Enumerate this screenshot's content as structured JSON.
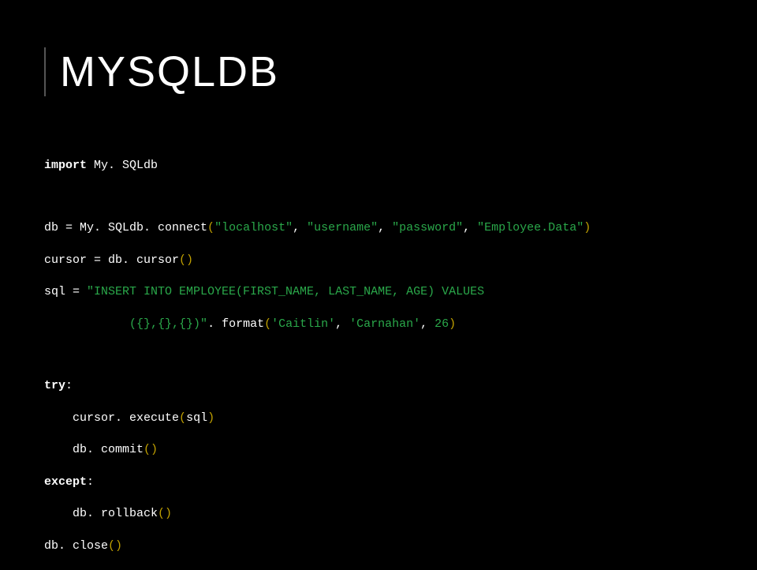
{
  "slide": {
    "title": "MYSQLDB"
  },
  "code": {
    "l1": {
      "kw": "import",
      "rest": " My. SQLdb"
    },
    "l2a": "db = My. SQLdb. connect",
    "l2p1": "(",
    "l2s1": "\"localhost\"",
    "l2c1": ", ",
    "l2s2": "\"username\"",
    "l2c2": ", ",
    "l2s3": "\"password\"",
    "l2c3": ", ",
    "l2s4": "\"Employee.Data\"",
    "l2p2": ")",
    "l3a": "cursor = db. cursor",
    "l3p": "()",
    "l4a": "sql = ",
    "l4s": "\"INSERT INTO EMPLOYEE(FIRST_NAME, LAST_NAME, AGE) VALUES",
    "l5pad": "            ",
    "l5s": "({},{},{})\"",
    "l5m": ". format",
    "l5p1": "(",
    "l5a1": "'Caitlin'",
    "l5c1": ", ",
    "l5a2": "'Carnahan'",
    "l5c2": ", ",
    "l5n": "26",
    "l5p2": ")",
    "l6kw": "try",
    "l6c": ":",
    "l7pad": "    ",
    "l7a": "cursor. execute",
    "l7p1": "(",
    "l7v": "sql",
    "l7p2": ")",
    "l8pad": "    ",
    "l8a": "db. commit",
    "l8p": "()",
    "l9kw": "except",
    "l9c": ":",
    "l10pad": "    ",
    "l10a": "db. rollback",
    "l10p": "()",
    "l11a": "db. close",
    "l11p": "()"
  }
}
